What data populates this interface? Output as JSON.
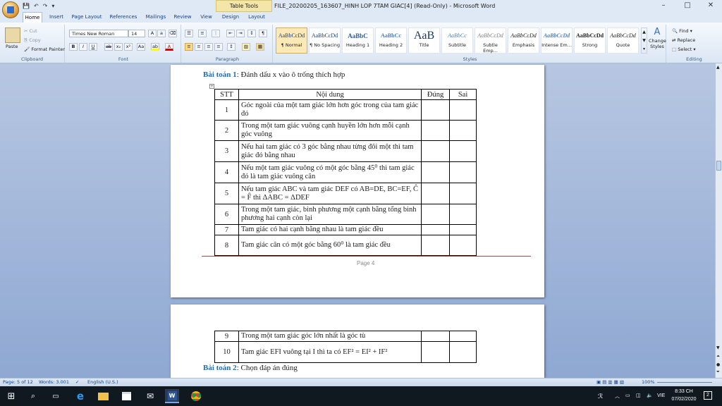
{
  "window": {
    "title": "FILE_20200205_163607_HINH LOP 7TAM GIAC[4] (Read-Only) - Microsoft Word",
    "context_tab": "Table Tools"
  },
  "tabs": [
    "Home",
    "Insert",
    "Page Layout",
    "References",
    "Mailings",
    "Review",
    "View",
    "Design",
    "Layout"
  ],
  "clipboard": {
    "paste": "Paste",
    "cut": "Cut",
    "copy": "Copy",
    "format_painter": "Format Painter",
    "label": "Clipboard"
  },
  "font": {
    "name": "Times New Roman",
    "size": "14",
    "label": "Font"
  },
  "paragraph": {
    "label": "Paragraph"
  },
  "styles": {
    "label": "Styles",
    "items": [
      {
        "preview": "AaBbCcDd",
        "name": "¶ Normal"
      },
      {
        "preview": "AaBbCcDd",
        "name": "¶ No Spacing"
      },
      {
        "preview": "AaBbC",
        "name": "Heading 1"
      },
      {
        "preview": "AaBbCc",
        "name": "Heading 2"
      },
      {
        "preview": "AaB",
        "name": "Title"
      },
      {
        "preview": "AaBbCc",
        "name": "Subtitle"
      },
      {
        "preview": "AaBbCcDd",
        "name": "Subtle Emp..."
      },
      {
        "preview": "AaBbCcDd",
        "name": "Emphasis"
      },
      {
        "preview": "AaBbCcDd",
        "name": "Intense Em..."
      },
      {
        "preview": "AaBbCcDd",
        "name": "Strong"
      },
      {
        "preview": "AaBbCcDd",
        "name": "Quote"
      }
    ],
    "change": "Change Styles"
  },
  "editing": {
    "find": "Find",
    "replace": "Replace",
    "select": "Select",
    "label": "Editing"
  },
  "doc": {
    "bai1_label": "Bài toán 1",
    "bai1_text": ": Đánh dấu x vào ô trống thích hợp",
    "headers": [
      "STT",
      "Nội dung",
      "Đúng",
      "Sai"
    ],
    "rows": [
      {
        "n": "1",
        "t": "Góc ngoài của một tam giác lớn hơn góc trong của tam giác đó"
      },
      {
        "n": "2",
        "t": "Trong một tam giác vuông cạnh huyền lớn hơn mỗi cạnh góc vuông"
      },
      {
        "n": "3",
        "t": "Nếu hai tam giác có 3 góc bằng nhau từng đôi một thì tam giác đó bằng nhau"
      },
      {
        "n": "4",
        "t": "Nếu một tam giác vuông có một góc bằng 45⁰ thì tam giác đó là tam giác vuông cân"
      },
      {
        "n": "5",
        "t": "Nếu tam giác ABC và tam giác DEF có AB=DE, BC=EF, Ĉ = F̂ thì ΔABC = ΔDEF"
      },
      {
        "n": "6",
        "t": "Trong một tam giác, bình phương một cạnh bằng tổng bình phương hai cạnh còn lại"
      },
      {
        "n": "7",
        "t": "Tam giác có hai cạnh bằng nhau là tam giác đều"
      },
      {
        "n": "8",
        "t": "Tam giác cân có một góc bằng 60⁰ là tam giác đều"
      }
    ],
    "page_footer": "Page 4",
    "rows2": [
      {
        "n": "9",
        "t": "Trong một tam giác góc lớn nhất là góc tù"
      },
      {
        "n": "10",
        "t": "Tam giác EFI vuông tại I thì ta có EF² = EI² + IF²"
      }
    ],
    "bai2_label": "Bài toán 2",
    "bai2_text": ": Chọn đáp án đúng"
  },
  "status": {
    "page": "Page: 5 of 12",
    "words": "Words: 3.001",
    "lang": "English (U.S.)",
    "zoom": "100%"
  },
  "tray": {
    "lang": "VIE",
    "time": "8:33 CH",
    "date": "07/02/2020",
    "notif": "2"
  }
}
